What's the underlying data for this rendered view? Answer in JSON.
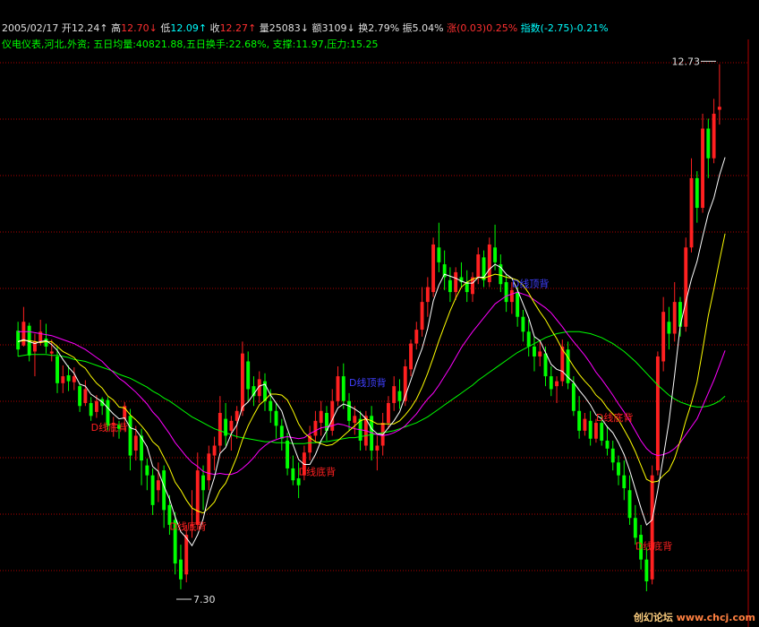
{
  "header": {
    "date": "2005/02/17",
    "open_label": "开",
    "open": "12.24",
    "high_label": "高",
    "high": "12.70",
    "low_label": "低",
    "low": "12.09",
    "close_label": "收",
    "close": "12.27",
    "vol_label": "量",
    "vol": "25083",
    "amt_label": "额",
    "amt": "3109",
    "turn_label": "换",
    "turn": "2.79%",
    "amp_label": "振",
    "amp": "5.04%",
    "chg_label": "涨",
    "chg": "(0.03)0.25%",
    "index_label": "指数",
    "index": "(-2.75)-0.21%"
  },
  "info": {
    "industry": "仪电仪表,河北,外资;",
    "avgvol_label": "五日均量:",
    "avgvol": "40821.88",
    "turn5_label": "五日换手:",
    "turn5": "22.68%",
    "support_label": "支撑:",
    "support": "11.97",
    "resist_label": "压力:",
    "resist": "15.25"
  },
  "watermark": {
    "part1": "创幻论坛",
    "part2": "www.chcj.com"
  },
  "colors": {
    "up": "#ff2020",
    "down": "#00ff00",
    "ma5": "#ffffff",
    "ma10": "#ffff00",
    "ma20": "#ff00ff",
    "ma60": "#00ff00",
    "grid": "#b00000",
    "blue": "#4040ff"
  },
  "chart_data": {
    "type": "candlestick",
    "ylim": [
      7.2,
      12.95
    ],
    "price_labels": [
      {
        "text": "12.73",
        "value": 12.73
      },
      {
        "text": "7.30",
        "value": 7.3
      }
    ],
    "annotations": [
      {
        "text": "D线底背",
        "index": 13,
        "value": 9.0,
        "color": "red"
      },
      {
        "text": "D线底背",
        "index": 27,
        "value": 8.0,
        "color": "red"
      },
      {
        "text": "D线底背",
        "index": 50,
        "value": 8.55,
        "color": "red"
      },
      {
        "text": "D线顶背",
        "index": 59,
        "value": 9.45,
        "color": "blue"
      },
      {
        "text": "D线顶背",
        "index": 88,
        "value": 10.45,
        "color": "blue"
      },
      {
        "text": "D线底背",
        "index": 103,
        "value": 9.1,
        "color": "red"
      },
      {
        "text": "D线底背",
        "index": 110,
        "value": 7.8,
        "color": "red"
      }
    ],
    "candles": [
      [
        10.01,
        10.1,
        9.75,
        9.82
      ],
      [
        9.86,
        10.25,
        9.85,
        10.1
      ],
      [
        10.06,
        10.09,
        9.7,
        9.76
      ],
      [
        9.8,
        9.98,
        9.55,
        9.9
      ],
      [
        9.9,
        10.12,
        9.86,
        10.0
      ],
      [
        9.93,
        10.08,
        9.78,
        9.85
      ],
      [
        9.78,
        9.92,
        9.7,
        9.8
      ],
      [
        9.75,
        9.86,
        9.38,
        9.48
      ],
      [
        9.48,
        9.66,
        9.38,
        9.55
      ],
      [
        9.56,
        9.66,
        9.4,
        9.5
      ],
      [
        9.49,
        9.64,
        9.41,
        9.55
      ],
      [
        9.45,
        9.48,
        9.19,
        9.25
      ],
      [
        9.28,
        9.51,
        9.25,
        9.42
      ],
      [
        9.28,
        9.34,
        9.1,
        9.15
      ],
      [
        9.19,
        9.36,
        9.13,
        9.3
      ],
      [
        9.32,
        9.34,
        9.16,
        9.25
      ],
      [
        9.31,
        9.34,
        9.0,
        9.05
      ],
      [
        9.06,
        9.14,
        8.94,
        9.08
      ],
      [
        9.06,
        9.1,
        8.92,
        9.02
      ],
      [
        9.12,
        9.29,
        9.0,
        9.25
      ],
      [
        9.15,
        9.22,
        8.6,
        8.75
      ],
      [
        8.8,
        9.05,
        8.7,
        8.95
      ],
      [
        8.95,
        9.02,
        8.45,
        8.7
      ],
      [
        8.65,
        8.72,
        8.4,
        8.55
      ],
      [
        8.55,
        8.62,
        8.15,
        8.25
      ],
      [
        8.4,
        8.68,
        8.28,
        8.5
      ],
      [
        8.6,
        8.65,
        8.02,
        8.2
      ],
      [
        8.25,
        8.35,
        7.95,
        8.05
      ],
      [
        8.1,
        8.18,
        7.55,
        7.66
      ],
      [
        7.7,
        7.85,
        7.4,
        7.5
      ],
      [
        7.55,
        8.05,
        7.47,
        7.95
      ],
      [
        8.05,
        8.4,
        7.92,
        8.05
      ],
      [
        8.05,
        8.78,
        8.0,
        8.6
      ],
      [
        8.55,
        8.65,
        8.2,
        8.4
      ],
      [
        8.5,
        8.85,
        8.4,
        8.77
      ],
      [
        8.75,
        8.94,
        8.6,
        8.85
      ],
      [
        8.85,
        9.35,
        8.78,
        9.18
      ],
      [
        9.12,
        9.28,
        8.85,
        8.95
      ],
      [
        9.0,
        9.15,
        8.8,
        9.1
      ],
      [
        9.1,
        9.25,
        8.92,
        9.2
      ],
      [
        9.2,
        9.9,
        9.15,
        9.78
      ],
      [
        9.7,
        9.8,
        9.3,
        9.42
      ],
      [
        9.45,
        9.55,
        9.25,
        9.35
      ],
      [
        9.35,
        9.6,
        9.28,
        9.52
      ],
      [
        9.5,
        9.58,
        9.2,
        9.3
      ],
      [
        9.3,
        9.42,
        9.08,
        9.2
      ],
      [
        9.2,
        9.28,
        8.92,
        9.05
      ],
      [
        9.05,
        9.12,
        8.8,
        8.92
      ],
      [
        8.9,
        8.98,
        8.55,
        8.62
      ],
      [
        8.62,
        8.75,
        8.45,
        8.5
      ],
      [
        8.52,
        8.68,
        8.32,
        8.45
      ],
      [
        8.55,
        8.85,
        8.5,
        8.78
      ],
      [
        8.78,
        9.05,
        8.7,
        8.95
      ],
      [
        8.95,
        9.2,
        8.88,
        9.1
      ],
      [
        9.08,
        9.3,
        8.95,
        9.2
      ],
      [
        9.18,
        9.25,
        8.9,
        9.0
      ],
      [
        9.0,
        9.42,
        8.95,
        9.3
      ],
      [
        9.3,
        9.65,
        9.25,
        9.55
      ],
      [
        9.55,
        9.68,
        9.22,
        9.3
      ],
      [
        9.3,
        9.38,
        9.0,
        9.1
      ],
      [
        9.08,
        9.25,
        8.96,
        9.15
      ],
      [
        9.12,
        9.2,
        8.8,
        8.9
      ],
      [
        8.85,
        9.2,
        8.8,
        9.15
      ],
      [
        9.15,
        9.25,
        8.7,
        8.8
      ],
      [
        8.8,
        8.95,
        8.6,
        8.85
      ],
      [
        8.85,
        9.18,
        8.75,
        9.08
      ],
      [
        9.08,
        9.35,
        9.02,
        9.28
      ],
      [
        9.28,
        9.55,
        9.2,
        9.45
      ],
      [
        9.4,
        9.52,
        9.22,
        9.3
      ],
      [
        9.3,
        9.72,
        9.25,
        9.65
      ],
      [
        9.62,
        9.92,
        9.55,
        9.88
      ],
      [
        9.88,
        10.1,
        9.82,
        10.02
      ],
      [
        10.02,
        10.45,
        9.95,
        10.3
      ],
      [
        10.3,
        10.55,
        10.15,
        10.45
      ],
      [
        10.4,
        10.95,
        10.35,
        10.88
      ],
      [
        10.85,
        11.1,
        10.6,
        10.7
      ],
      [
        10.68,
        10.82,
        10.42,
        10.55
      ],
      [
        10.52,
        10.65,
        10.3,
        10.4
      ],
      [
        10.4,
        10.65,
        10.32,
        10.6
      ],
      [
        10.55,
        10.7,
        10.45,
        10.5
      ],
      [
        10.5,
        10.62,
        10.3,
        10.4
      ],
      [
        10.38,
        10.6,
        10.3,
        10.55
      ],
      [
        10.55,
        10.85,
        10.48,
        10.78
      ],
      [
        10.75,
        10.82,
        10.45,
        10.52
      ],
      [
        10.5,
        10.95,
        10.45,
        10.88
      ],
      [
        10.85,
        11.08,
        10.62,
        10.7
      ],
      [
        10.68,
        10.78,
        10.4,
        10.48
      ],
      [
        10.5,
        10.58,
        10.2,
        10.3
      ],
      [
        10.3,
        10.5,
        10.18,
        10.42
      ],
      [
        10.4,
        10.45,
        10.05,
        10.15
      ],
      [
        10.15,
        10.22,
        9.9,
        10.0
      ],
      [
        10.0,
        10.12,
        9.75,
        9.85
      ],
      [
        9.85,
        9.95,
        9.6,
        9.75
      ],
      [
        9.75,
        9.9,
        9.65,
        9.8
      ],
      [
        9.78,
        9.85,
        9.45,
        9.55
      ],
      [
        9.55,
        9.65,
        9.35,
        9.42
      ],
      [
        9.45,
        9.55,
        9.28,
        9.5
      ],
      [
        9.5,
        9.92,
        9.45,
        9.85
      ],
      [
        9.82,
        9.9,
        9.42,
        9.48
      ],
      [
        9.48,
        9.55,
        9.15,
        9.2
      ],
      [
        9.2,
        9.35,
        8.92,
        9.0
      ],
      [
        9.0,
        9.18,
        8.95,
        9.12
      ],
      [
        9.1,
        9.2,
        8.85,
        8.92
      ],
      [
        8.92,
        9.12,
        8.88,
        9.08
      ],
      [
        9.08,
        9.15,
        8.85,
        8.9
      ],
      [
        8.9,
        9.05,
        8.75,
        8.82
      ],
      [
        8.82,
        8.9,
        8.6,
        8.68
      ],
      [
        8.68,
        8.75,
        8.45,
        8.55
      ],
      [
        8.55,
        8.7,
        8.3,
        8.42
      ],
      [
        8.4,
        8.55,
        8.05,
        8.12
      ],
      [
        8.12,
        8.25,
        7.85,
        7.92
      ],
      [
        7.95,
        8.05,
        7.6,
        7.7
      ],
      [
        7.7,
        7.82,
        7.38,
        7.48
      ],
      [
        7.5,
        8.65,
        7.45,
        8.55
      ],
      [
        8.6,
        9.8,
        8.55,
        9.75
      ],
      [
        9.7,
        10.35,
        9.6,
        10.2
      ],
      [
        10.1,
        10.25,
        9.82,
        9.98
      ],
      [
        9.98,
        10.5,
        9.9,
        10.3
      ],
      [
        10.3,
        10.35,
        9.95,
        10.05
      ],
      [
        10.05,
        10.95,
        10.0,
        10.85
      ],
      [
        10.85,
        11.75,
        10.8,
        11.55
      ],
      [
        11.55,
        11.62,
        11.1,
        11.25
      ],
      [
        11.25,
        12.2,
        11.2,
        12.05
      ],
      [
        12.05,
        12.15,
        11.55,
        11.75
      ],
      [
        11.75,
        12.35,
        11.7,
        12.2
      ],
      [
        12.24,
        12.7,
        12.09,
        12.27
      ]
    ],
    "ma5": [
      9.9,
      9.92,
      9.9,
      9.88,
      9.9,
      9.91,
      9.87,
      9.81,
      9.72,
      9.64,
      9.58,
      9.47,
      9.45,
      9.37,
      9.33,
      9.29,
      9.23,
      9.17,
      9.12,
      9.13,
      9.03,
      9.01,
      8.93,
      8.84,
      8.64,
      8.59,
      8.44,
      8.31,
      8.13,
      7.98,
      7.92,
      7.84,
      7.95,
      8.11,
      8.35,
      8.53,
      8.77,
      8.83,
      8.97,
      9.06,
      9.24,
      9.29,
      9.37,
      9.45,
      9.47,
      9.36,
      9.28,
      9.2,
      9.02,
      8.86,
      8.71,
      8.66,
      8.66,
      8.76,
      8.9,
      9.0,
      9.11,
      9.23,
      9.27,
      9.25,
      9.22,
      9.18,
      9.12,
      9.02,
      8.97,
      8.96,
      9.03,
      9.1,
      9.19,
      9.35,
      9.51,
      9.68,
      9.83,
      10.03,
      10.31,
      10.47,
      10.58,
      10.56,
      10.54,
      10.51,
      10.49,
      10.49,
      10.55,
      10.55,
      10.63,
      10.68,
      10.65,
      10.58,
      10.54,
      10.42,
      10.28,
      10.14,
      9.95,
      9.91,
      9.79,
      9.67,
      9.62,
      9.6,
      9.54,
      9.49,
      9.41,
      9.34,
      9.26,
      9.16,
      9.12,
      9.04,
      8.98,
      8.88,
      8.76,
      8.6,
      8.41,
      8.22,
      8.05,
      8.1,
      8.4,
      8.74,
      9.09,
      9.56,
      10.06,
      10.3,
      10.53,
      10.71,
      10.96,
      11.19,
      11.35,
      11.58,
      11.76
    ],
    "ma10": [
      9.9,
      9.91,
      9.91,
      9.9,
      9.89,
      9.9,
      9.9,
      9.85,
      9.8,
      9.77,
      9.74,
      9.67,
      9.63,
      9.55,
      9.48,
      9.43,
      9.35,
      9.31,
      9.24,
      9.23,
      9.16,
      9.11,
      9.05,
      8.98,
      8.89,
      8.84,
      8.73,
      8.62,
      8.48,
      8.4,
      8.3,
      8.22,
      8.19,
      8.17,
      8.22,
      8.28,
      8.4,
      8.47,
      8.6,
      8.74,
      8.91,
      9.05,
      9.16,
      9.26,
      9.31,
      9.37,
      9.37,
      9.36,
      9.31,
      9.2,
      9.07,
      8.98,
      8.93,
      8.89,
      8.87,
      8.85,
      8.86,
      8.9,
      8.95,
      9.0,
      9.05,
      9.1,
      9.12,
      9.1,
      9.07,
      9.07,
      9.07,
      9.07,
      9.1,
      9.16,
      9.23,
      9.32,
      9.44,
      9.58,
      9.74,
      9.91,
      10.06,
      10.21,
      10.34,
      10.45,
      10.5,
      10.53,
      10.55,
      10.54,
      10.56,
      10.58,
      10.57,
      10.55,
      10.54,
      10.52,
      10.47,
      10.39,
      10.29,
      10.2,
      10.12,
      10.02,
      9.93,
      9.82,
      9.74,
      9.65,
      9.57,
      9.5,
      9.44,
      9.36,
      9.31,
      9.23,
      9.17,
      9.11,
      9.01,
      8.91,
      8.79,
      8.65,
      8.51,
      8.48,
      8.49,
      8.55,
      8.6,
      8.72,
      8.9,
      9.1,
      9.28,
      9.49,
      9.82,
      10.16,
      10.43,
      10.72,
      10.99
    ],
    "ma20": [
      10.0,
      10.0,
      10.0,
      9.99,
      9.98,
      9.97,
      9.96,
      9.94,
      9.92,
      9.9,
      9.88,
      9.85,
      9.82,
      9.78,
      9.74,
      9.7,
      9.64,
      9.59,
      9.53,
      9.49,
      9.44,
      9.39,
      9.33,
      9.27,
      9.19,
      9.13,
      9.05,
      8.97,
      8.88,
      8.81,
      8.74,
      8.68,
      8.64,
      8.59,
      8.57,
      8.56,
      8.57,
      8.56,
      8.56,
      8.58,
      8.62,
      8.67,
      8.73,
      8.8,
      8.85,
      8.89,
      8.91,
      8.93,
      8.94,
      8.93,
      8.92,
      8.93,
      8.97,
      9.0,
      9.03,
      9.04,
      9.05,
      9.07,
      9.06,
      9.04,
      9.02,
      9.01,
      9.0,
      8.98,
      8.96,
      8.95,
      8.96,
      8.98,
      9.01,
      9.05,
      9.11,
      9.17,
      9.25,
      9.32,
      9.38,
      9.46,
      9.55,
      9.64,
      9.74,
      9.84,
      9.92,
      10.0,
      10.07,
      10.14,
      10.21,
      10.28,
      10.32,
      10.36,
      10.38,
      10.4,
      10.38,
      10.36,
      10.32,
      10.28,
      10.24,
      10.19,
      10.12,
      10.05,
      9.97,
      9.9,
      9.83,
      9.76,
      9.68,
      9.59,
      9.52,
      9.44,
      9.36,
      9.27,
      9.19,
      9.1,
      9.0,
      8.9,
      8.82,
      8.77,
      8.75,
      8.76,
      8.78,
      8.82,
      8.88,
      8.96,
      9.04,
      9.12,
      9.25,
      9.38,
      9.51,
      9.66,
      9.81
    ],
    "ma60": [
      9.75,
      9.76,
      9.77,
      9.77,
      9.77,
      9.77,
      9.76,
      9.76,
      9.75,
      9.74,
      9.72,
      9.71,
      9.7,
      9.68,
      9.66,
      9.64,
      9.62,
      9.6,
      9.57,
      9.55,
      9.53,
      9.5,
      9.47,
      9.44,
      9.4,
      9.37,
      9.33,
      9.3,
      9.26,
      9.22,
      9.18,
      9.14,
      9.11,
      9.08,
      9.05,
      9.02,
      9.0,
      8.98,
      8.96,
      8.94,
      8.93,
      8.92,
      8.91,
      8.9,
      8.89,
      8.89,
      8.88,
      8.88,
      8.88,
      8.87,
      8.87,
      8.87,
      8.88,
      8.88,
      8.89,
      8.89,
      8.9,
      8.91,
      8.92,
      8.93,
      8.93,
      8.94,
      8.95,
      8.96,
      8.97,
      8.98,
      8.99,
      9.0,
      9.02,
      9.04,
      9.06,
      9.08,
      9.11,
      9.14,
      9.18,
      9.22,
      9.26,
      9.3,
      9.34,
      9.38,
      9.42,
      9.46,
      9.51,
      9.55,
      9.59,
      9.63,
      9.67,
      9.71,
      9.75,
      9.79,
      9.82,
      9.85,
      9.88,
      9.91,
      9.94,
      9.96,
      9.98,
      9.99,
      10.0,
      10.0,
      10.0,
      9.99,
      9.98,
      9.96,
      9.94,
      9.91,
      9.88,
      9.84,
      9.8,
      9.75,
      9.7,
      9.64,
      9.58,
      9.52,
      9.46,
      9.41,
      9.36,
      9.32,
      9.29,
      9.27,
      9.25,
      9.24,
      9.24,
      9.25,
      9.27,
      9.3,
      9.35
    ]
  }
}
